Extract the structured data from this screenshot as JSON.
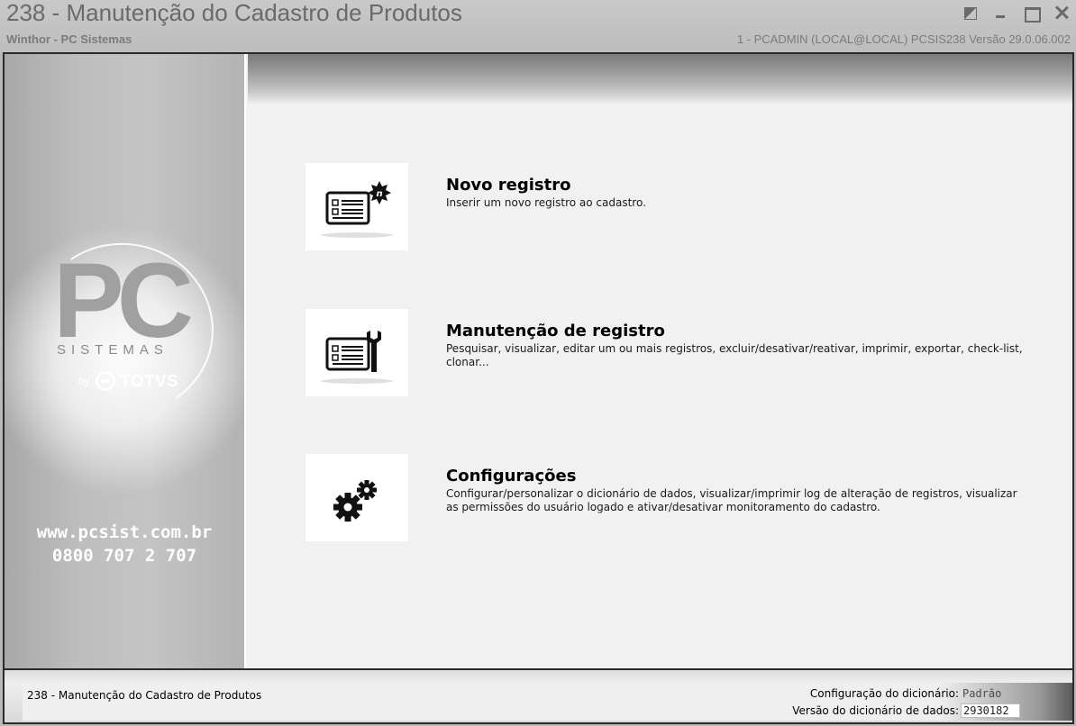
{
  "window": {
    "title": "238 - Manutenção do Cadastro de Produtos",
    "subtitle": "Winthor - PC Sistemas",
    "session_info": "1 - PCADMIN (LOCAL@LOCAL)   PCSIS238  Versão  29.0.06.002",
    "controls": [
      "restore-icon",
      "minimize-icon",
      "maximize-icon",
      "close-icon"
    ]
  },
  "sidebar": {
    "logo_letters": "PC",
    "logo_sistemas": "SISTEMAS",
    "logo_by": "by",
    "logo_totvs": "TOTVS",
    "website": "www.pcsist.com.br",
    "phone": "0800 707 2 707"
  },
  "actions": [
    {
      "title": "Novo registro",
      "description": "Inserir um novo registro ao cadastro.",
      "icon": "new-record-icon"
    },
    {
      "title": "Manutenção de registro",
      "description": "Pesquisar, visualizar, editar um ou mais registros, excluir/desativar/reativar, imprimir, exportar, check-list,  clonar...",
      "icon": "maintenance-record-icon"
    },
    {
      "title": "Configurações",
      "description": "Configurar/personalizar o dicionário de dados, visualizar/imprimir log de alteração de registros, visualizar as permissões do usuário logado e ativar/desativar monitoramento do cadastro.",
      "icon": "gears-icon"
    }
  ],
  "statusbar": {
    "routine": "238 - Manutenção do Cadastro de Produtos",
    "dict_config_label": "Configuração do dicionário:",
    "dict_config_value": "Padrão",
    "dict_version_label": "Versão do dicionário de dados:",
    "dict_version_value": "2930182"
  }
}
